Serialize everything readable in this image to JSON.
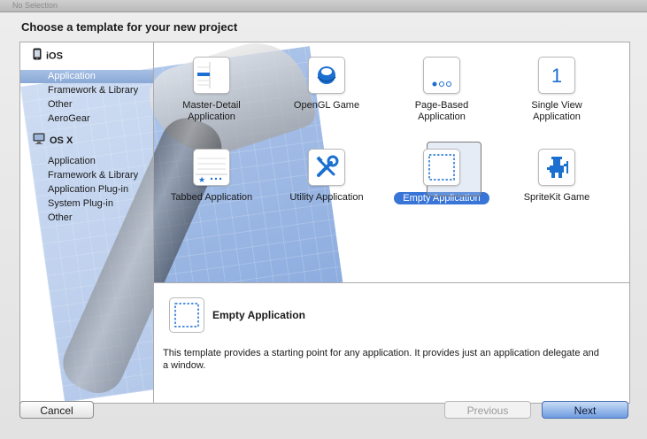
{
  "window": {
    "title_strip": "No Selection",
    "heading": "Choose a template for your new project"
  },
  "sidebar": {
    "sections": [
      {
        "name": "iOS",
        "icon": "iphone-icon",
        "items": [
          "Application",
          "Framework & Library",
          "Other",
          "AeroGear"
        ]
      },
      {
        "name": "OS X",
        "icon": "mac-icon",
        "items": [
          "Application",
          "Framework & Library",
          "Application Plug-in",
          "System Plug-in",
          "Other"
        ]
      }
    ],
    "selected": "iOS / Application"
  },
  "templates": [
    {
      "label": "Master-Detail\nApplication",
      "icon": "master-detail-icon"
    },
    {
      "label": "OpenGL Game",
      "icon": "opengl-icon"
    },
    {
      "label": "Page-Based\nApplication",
      "icon": "page-based-icon"
    },
    {
      "label": "Single View\nApplication",
      "icon": "single-view-icon"
    },
    {
      "label": "Tabbed Application",
      "icon": "tabbed-icon"
    },
    {
      "label": "Utility Application",
      "icon": "utility-tools-icon"
    },
    {
      "label": "Empty Application",
      "icon": "empty-app-icon",
      "selected": true
    },
    {
      "label": "SpriteKit Game",
      "icon": "spritekit-icon"
    }
  ],
  "description": {
    "title": "Empty Application",
    "text": "This template provides a starting point for any application. It provides just an application delegate and a window."
  },
  "buttons": {
    "cancel": "Cancel",
    "previous": "Previous",
    "next": "Next"
  },
  "colors": {
    "accent": "#3875d7",
    "icon_blue": "#1b6fd0",
    "sidebar_selection": "#8aa9d6"
  }
}
